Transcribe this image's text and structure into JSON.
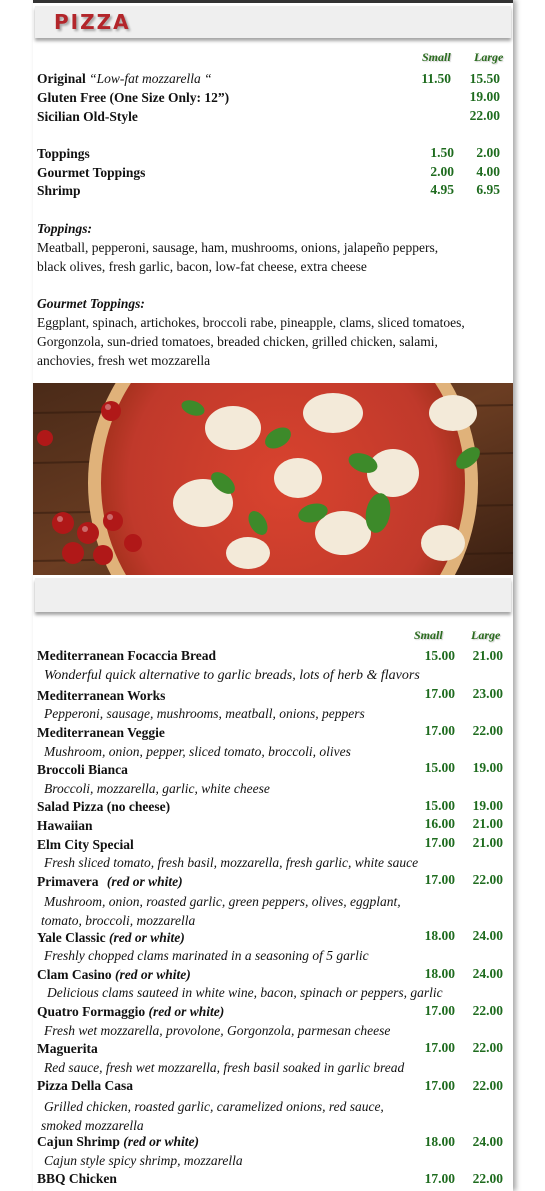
{
  "section1": {
    "title": "PIZZA",
    "col_small": "Small",
    "col_large": "Large",
    "rows": [
      {
        "name": "Original",
        "note": "“Low-fat mozzarella “",
        "small": "11.50",
        "large": "15.50"
      },
      {
        "name": "Gluten Free (One Size Only: 12”)",
        "note": "",
        "small": "",
        "large": "19.00"
      },
      {
        "name": "Sicilian Old-Style",
        "note": "",
        "small": "",
        "large": "22.00"
      },
      {
        "name": "Toppings",
        "note": "",
        "small": "1.50",
        "large": "2.00"
      },
      {
        "name": "Gourmet Toppings",
        "note": "",
        "small": "2.00",
        "large": "4.00"
      },
      {
        "name": "Shrimp",
        "note": "",
        "small": "4.95",
        "large": "6.95"
      }
    ],
    "toppings_heading": "Toppings:",
    "toppings_text": "Meatball, pepperoni, sausage, ham, mushrooms, onions, jalapeño peppers, black olives, fresh garlic, bacon, low-fat cheese, extra cheese",
    "gourmet_heading": "Gourmet Toppings:",
    "gourmet_text": "Eggplant, spinach, artichokes, broccoli rabe, pineapple, clams, sliced tomatoes, Gorgonzola, sun-dried tomatoes, breaded chicken, grilled chicken, salami, anchovies, fresh wet mozzarella"
  },
  "section2": {
    "col_small": "Small",
    "col_large": "Large",
    "items": [
      {
        "name": "Mediterranean Focaccia Bread",
        "suffix": "",
        "desc": "Wonderful quick alternative to garlic breads, lots of herb & flavors",
        "small": "15.00",
        "large": "21.00"
      },
      {
        "name": "Mediterranean Works",
        "suffix": "",
        "desc": "Pepperoni, sausage, mushrooms, meatball, onions, peppers",
        "small": "17.00",
        "large": "23.00"
      },
      {
        "name": "Mediterranean Veggie",
        "suffix": "",
        "desc": "Mushroom, onion, pepper, sliced tomato, broccoli, olives",
        "small": "17.00",
        "large": "22.00"
      },
      {
        "name": "Broccoli Bianca",
        "suffix": "",
        "desc": "Broccoli, mozzarella, garlic, white cheese",
        "small": "15.00",
        "large": "19.00"
      },
      {
        "name": "Salad Pizza (no cheese)",
        "suffix": "",
        "desc": "",
        "small": "15.00",
        "large": "19.00"
      },
      {
        "name": "Hawaiian",
        "suffix": "",
        "desc": "",
        "small": "16.00",
        "large": "21.00"
      },
      {
        "name": "Elm City Special",
        "suffix": "",
        "desc": "Fresh sliced tomato, fresh basil, mozzarella, fresh garlic, white sauce",
        "small": "17.00",
        "large": "21.00"
      },
      {
        "name": "Primavera",
        "suffix": "(red or white)",
        "desc": "Mushroom, onion, roasted garlic, green peppers, olives, eggplant, tomato, broccoli, mozzarella",
        "small": "17.00",
        "large": "22.00"
      },
      {
        "name": "Yale Classic",
        "suffix": "(red or white)",
        "desc": "Freshly chopped clams marinated in a seasoning of 5 garlic",
        "small": "18.00",
        "large": "24.00"
      },
      {
        "name": "Clam Casino",
        "suffix": "(red or white)",
        "desc": "Delicious clams sauteed in white wine, bacon, spinach or peppers, garlic",
        "small": "18.00",
        "large": "24.00"
      },
      {
        "name": "Quatro Formaggio",
        "suffix": "(red or white)",
        "desc": "Fresh wet mozzarella, provolone, Gorgonzola, parmesan cheese",
        "small": "17.00",
        "large": "22.00"
      },
      {
        "name": "Maguerita",
        "suffix": "",
        "desc": "Red sauce, fresh wet mozzarella, fresh basil soaked in garlic bread",
        "small": "17.00",
        "large": "22.00"
      },
      {
        "name": "Pizza Della Casa",
        "suffix": "",
        "desc": "Grilled chicken, roasted garlic, caramelized onions, red sauce, smoked mozzarella",
        "small": "17.00",
        "large": "22.00"
      },
      {
        "name": "Cajun Shrimp",
        "suffix": "(red or white)",
        "desc": "Cajun style spicy shrimp, mozzarella",
        "small": "18.00",
        "large": "24.00"
      },
      {
        "name": "BBQ Chicken",
        "suffix": "",
        "desc": "",
        "small": "17.00",
        "large": "22.00"
      }
    ]
  }
}
